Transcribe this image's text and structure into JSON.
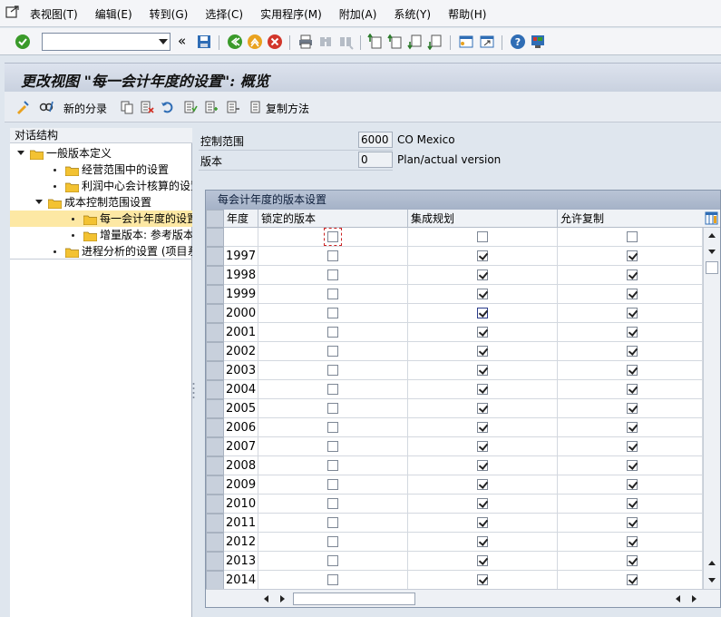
{
  "menubar": {
    "items": [
      "表视图(T)",
      "编辑(E)",
      "转到(G)",
      "选择(C)",
      "实用程序(M)",
      "附加(A)",
      "系统(Y)",
      "帮助(H)"
    ]
  },
  "toolbar": {
    "command_value": "",
    "nav_back_glyph": "«"
  },
  "title": "更改视图 \"每一会计年度的设置\": 概览",
  "apptoolbar": {
    "new_entries_label": "新的分录",
    "copy_method_label": "复制方法"
  },
  "tree": {
    "header": "对话结构",
    "nodes": [
      {
        "label": "一般版本定义",
        "level": 0,
        "type": "expanded"
      },
      {
        "label": "经营范围中的设置",
        "level": 1,
        "type": "leaf"
      },
      {
        "label": "利润中心会计核算的设置",
        "level": 1,
        "type": "leaf"
      },
      {
        "label": "成本控制范围设置",
        "level": 1,
        "type": "expanded"
      },
      {
        "label": "每一会计年度的设置",
        "level": 2,
        "type": "leaf",
        "selected": true
      },
      {
        "label": "增量版本: 参考版本的分",
        "level": 2,
        "type": "leaf"
      },
      {
        "label": "进程分析的设置 (项目系统",
        "level": 1,
        "type": "leaf"
      }
    ]
  },
  "fields": {
    "controlling_area_label": "控制范围",
    "controlling_area_value": "6000",
    "controlling_area_desc": "CO Mexico",
    "version_label": "版本",
    "version_value": "0",
    "version_desc": "Plan/actual version"
  },
  "table": {
    "title": "每会计年度的版本设置",
    "columns": [
      "年度",
      "锁定的版本",
      "集成规划",
      "允许复制"
    ],
    "rows": [
      {
        "year": "",
        "locked": false,
        "integrated": false,
        "copy": false
      },
      {
        "year": "1997",
        "locked": false,
        "integrated": true,
        "copy": true
      },
      {
        "year": "1998",
        "locked": false,
        "integrated": true,
        "copy": true
      },
      {
        "year": "1999",
        "locked": false,
        "integrated": true,
        "copy": true
      },
      {
        "year": "2000",
        "locked": false,
        "integrated": true,
        "copy": true
      },
      {
        "year": "2001",
        "locked": false,
        "integrated": true,
        "copy": true
      },
      {
        "year": "2002",
        "locked": false,
        "integrated": true,
        "copy": true
      },
      {
        "year": "2003",
        "locked": false,
        "integrated": true,
        "copy": true
      },
      {
        "year": "2004",
        "locked": false,
        "integrated": true,
        "copy": true
      },
      {
        "year": "2005",
        "locked": false,
        "integrated": true,
        "copy": true
      },
      {
        "year": "2006",
        "locked": false,
        "integrated": true,
        "copy": true
      },
      {
        "year": "2007",
        "locked": false,
        "integrated": true,
        "copy": true
      },
      {
        "year": "2008",
        "locked": false,
        "integrated": true,
        "copy": true
      },
      {
        "year": "2009",
        "locked": false,
        "integrated": true,
        "copy": true
      },
      {
        "year": "2010",
        "locked": false,
        "integrated": true,
        "copy": true
      },
      {
        "year": "2011",
        "locked": false,
        "integrated": true,
        "copy": true
      },
      {
        "year": "2012",
        "locked": false,
        "integrated": true,
        "copy": true
      },
      {
        "year": "2013",
        "locked": false,
        "integrated": true,
        "copy": true
      },
      {
        "year": "2014",
        "locked": false,
        "integrated": true,
        "copy": true
      }
    ]
  },
  "colors": {
    "accent_green": "#3a9a2a",
    "accent_orange": "#e9a21f",
    "accent_red": "#d2362b",
    "icon_blue": "#2f6db5",
    "tree_selected": "#fde8a4",
    "folder_yellow": "#f3c232"
  }
}
